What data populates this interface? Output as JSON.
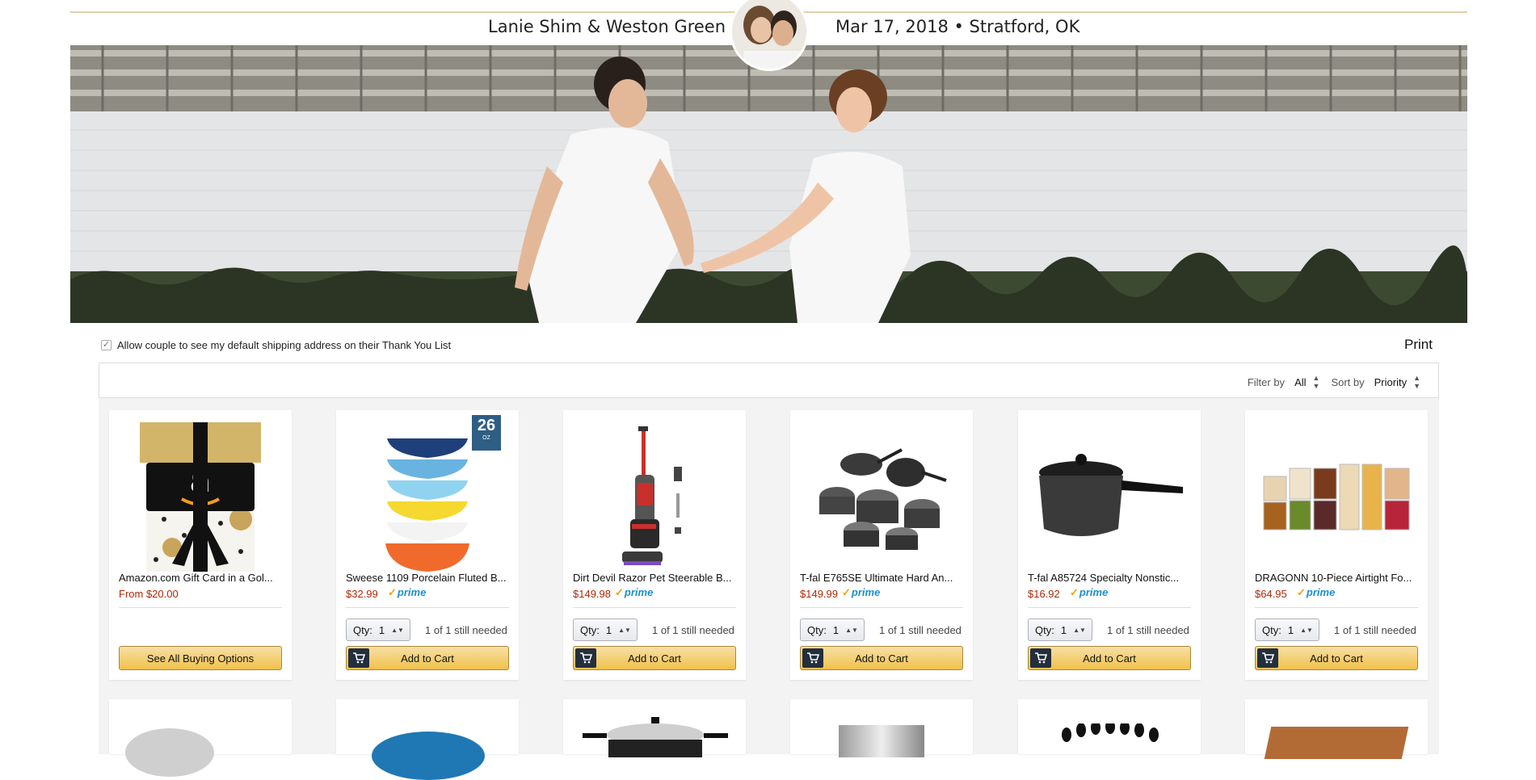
{
  "header": {
    "couple_names": "Lanie Shim & Weston Green",
    "date_location": "Mar 17, 2018 • Stratford, OK"
  },
  "options": {
    "allow_address_label": "Allow couple to see my default shipping address on their Thank You List",
    "allow_address_checked": true,
    "print_label": "Print"
  },
  "filters": {
    "filter_label": "Filter by",
    "filter_value": "All",
    "sort_label": "Sort by",
    "sort_value": "Priority"
  },
  "colors": {
    "price": "#b12704",
    "prime": "#1a8fcf",
    "button": "#f0c14b",
    "accent_line": "#e3cfa7"
  },
  "products": [
    {
      "title": "Amazon.com Gift Card in a Gol...",
      "price": "From $20.00",
      "prime": false,
      "button": "See All Buying Options",
      "icon": "gift-card"
    },
    {
      "title": "Sweese 1109 Porcelain Fluted B...",
      "price": "$32.99",
      "prime": true,
      "qty_label": "Qty:",
      "qty": "1",
      "needed": "1 of 1 still needed",
      "button": "Add to Cart",
      "badge": "26",
      "badge_sub": "OZ",
      "icon": "bowls"
    },
    {
      "title": "Dirt Devil Razor Pet Steerable B...",
      "price": "$149.98",
      "prime": true,
      "qty_label": "Qty:",
      "qty": "1",
      "needed": "1 of 1 still needed",
      "button": "Add to Cart",
      "icon": "vacuum"
    },
    {
      "title": "T-fal E765SE Ultimate Hard An...",
      "price": "$149.99",
      "prime": true,
      "qty_label": "Qty:",
      "qty": "1",
      "needed": "1 of 1 still needed",
      "button": "Add to Cart",
      "icon": "cookware-set"
    },
    {
      "title": "T-fal A85724 Specialty Nonstic...",
      "price": "$16.92",
      "prime": true,
      "qty_label": "Qty:",
      "qty": "1",
      "needed": "1 of 1 still needed",
      "button": "Add to Cart",
      "icon": "saucepan"
    },
    {
      "title": "DRAGONN 10-Piece Airtight Fo...",
      "price": "$64.95",
      "prime": true,
      "qty_label": "Qty:",
      "qty": "1",
      "needed": "1 of 1 still needed",
      "button": "Add to Cart",
      "icon": "containers"
    }
  ],
  "prime_text": "prime"
}
